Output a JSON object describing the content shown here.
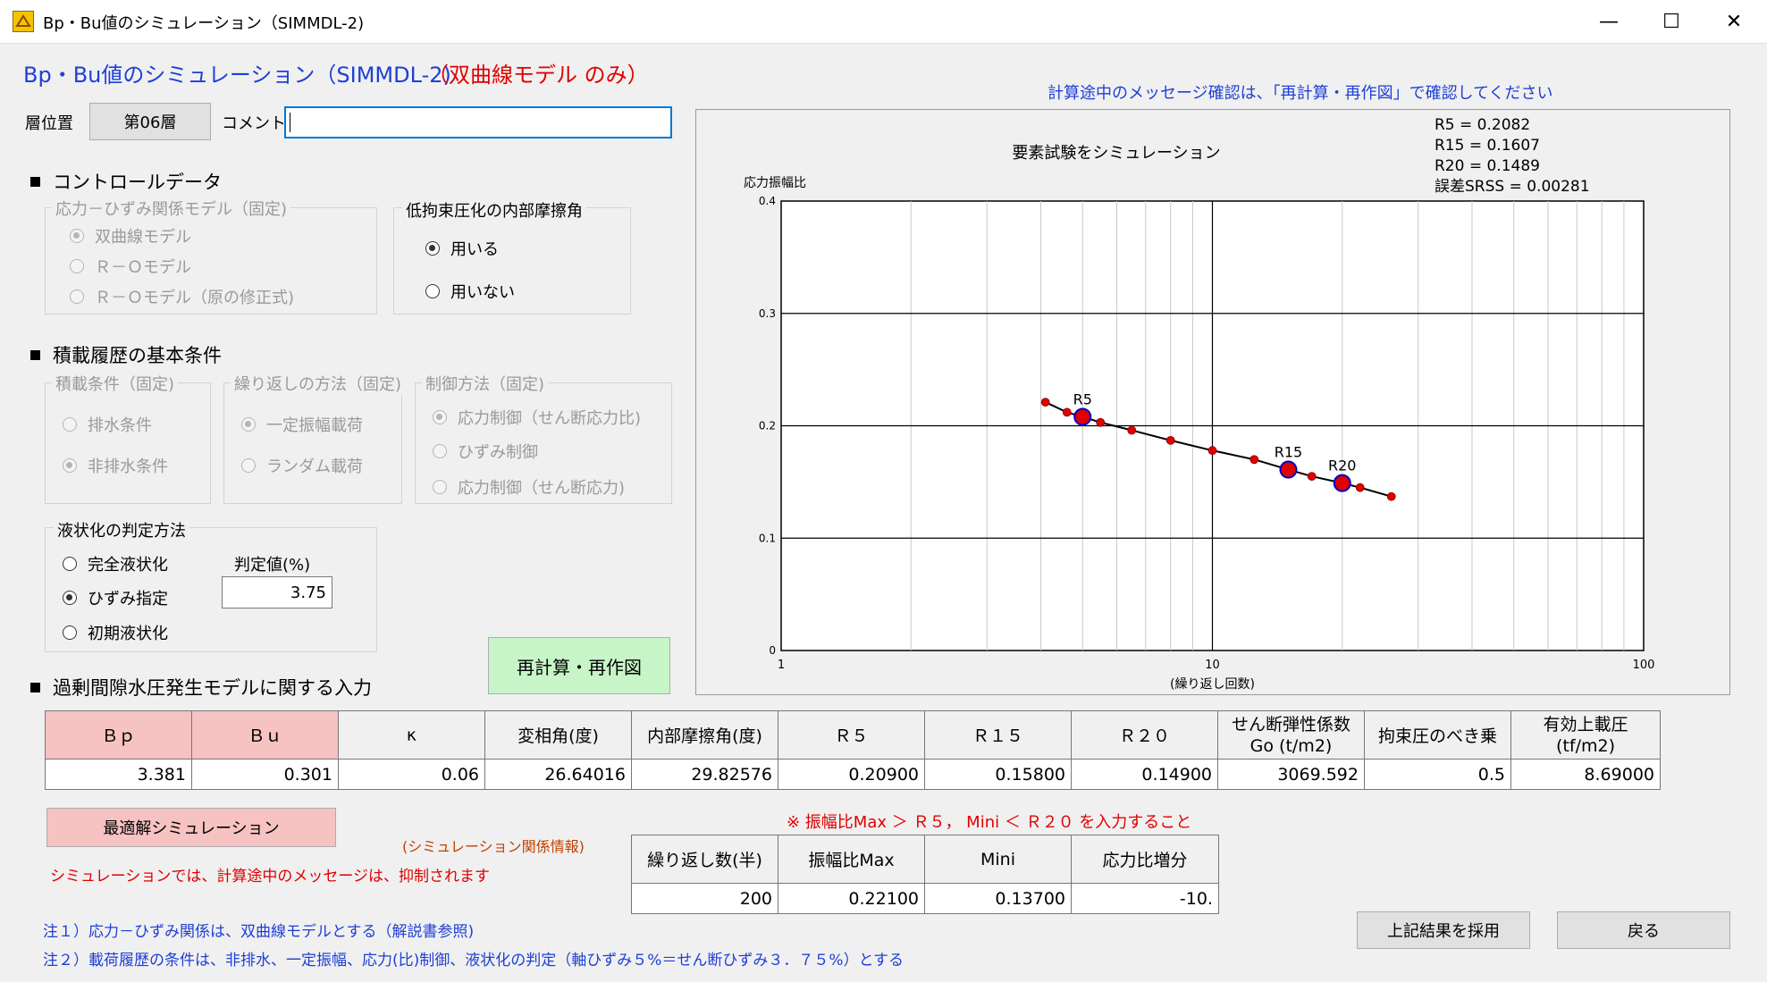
{
  "window": {
    "title": "Bp・Bu値のシミュレーション（SIMMDL-2)",
    "minimize": "—",
    "maximize": "☐",
    "close": "✕"
  },
  "header": {
    "title": "Bp・Bu値のシミュレーション（SIMMDL-2)",
    "subtitle": "（双曲線モデル のみ）",
    "notice": "計算途中のメッセージ確認は、「再計算・再作図」で確認してください"
  },
  "layer": {
    "label": "層位置",
    "value": "第06層",
    "comment_label": "コメント",
    "comment_value": ""
  },
  "control": {
    "title": "コントロールデータ",
    "model_group": "応力－ひずみ関係モデル（固定)",
    "model_options": [
      "双曲線モデル",
      "Ｒ－Ｏモデル",
      "Ｒ－Ｏモデル（原の修正式)"
    ],
    "model_selected": 0,
    "friction_group": "低拘束圧化の内部摩擦角",
    "friction_options": [
      "用いる",
      "用いない"
    ],
    "friction_selected": 0
  },
  "loading": {
    "title": "積載履歴の基本条件",
    "cond_group": "積載条件（固定)",
    "cond_options": [
      "排水条件",
      "非排水条件"
    ],
    "cond_selected": 1,
    "repeat_group": "繰り返しの方法（固定)",
    "repeat_options": [
      "一定振幅載荷",
      "ランダム載荷"
    ],
    "repeat_selected": 0,
    "ctrl_group": "制御方法（固定)",
    "ctrl_options": [
      "応力制御（せん断応力比)",
      "ひずみ制御",
      "応力制御（せん断応力)"
    ],
    "ctrl_selected": 0,
    "liq_group": "液状化の判定方法",
    "liq_options": [
      "完全液状化",
      "ひずみ指定",
      "初期液状化"
    ],
    "liq_selected": 1,
    "judge_label": "判定値(%)",
    "judge_value": "3.75"
  },
  "recalc_button": "再計算・再作図",
  "pore": {
    "title": "過剰間隙水圧発生モデルに関する入力",
    "headers": [
      "Ｂｐ",
      "Ｂｕ",
      "κ",
      "変相角(度)",
      "内部摩擦角(度)",
      "Ｒ５",
      "Ｒ１５",
      "Ｒ２０",
      "せん断弾性係数\nGo (t/m2)",
      "拘束圧のべき乗",
      "有効上載圧\n(tf/m2)"
    ],
    "values": [
      "3.381",
      "0.301",
      "0.06",
      "26.64016",
      "29.82576",
      "0.20900",
      "0.15800",
      "0.14900",
      "3069.592",
      "0.5",
      "8.69000"
    ]
  },
  "sim": {
    "button": "最適解シミュレーション",
    "info_label": "(シミュレーション関係情報)",
    "suppress_note": "シミュレーションでは、計算途中のメッセージは、抑制されます",
    "warning": "※ 振幅比Max ＞ Ｒ５， Mini ＜ Ｒ２０ を入力すること",
    "headers": [
      "繰り返し数(半)",
      "振幅比Max",
      "Mini",
      "応力比増分"
    ],
    "values": [
      "200",
      "0.22100",
      "0.13700",
      "-10."
    ]
  },
  "notes": [
    "注１）応力－ひずみ関係は、双曲線モデルとする（解説書参照)",
    "注２）載荷履歴の条件は、非排水、一定振幅、応力(比)制御、液状化の判定（軸ひずみ５%＝せん断ひずみ３．７５%）とする"
  ],
  "buttons": {
    "adopt": "上記結果を採用",
    "back": "戻る"
  },
  "chart_data": {
    "type": "scatter",
    "title": "要素試験をシミュレーション",
    "xlabel": "(繰り返し回数)",
    "ylabel": "応力振幅比",
    "x_scale": "log",
    "xlim": [
      1,
      100
    ],
    "ylim": [
      0,
      0.4
    ],
    "x_ticks": [
      "1",
      "10",
      "100"
    ],
    "y_ticks": [
      "0",
      "0.1",
      "0.2",
      "0.3",
      "0.4"
    ],
    "grid": true,
    "stats": [
      "R5  = 0.2082",
      "R15 = 0.1607",
      "R20 = 0.1489",
      "誤差SRSS = 0.00281"
    ],
    "series": [
      {
        "name": "",
        "x": [
          4.1,
          4.6,
          5.0,
          5.5,
          6.5,
          8.0,
          10.0,
          12.5,
          15.0,
          17.0,
          20.0,
          22.0,
          26.0
        ],
        "y": [
          0.221,
          0.212,
          0.208,
          0.203,
          0.196,
          0.187,
          0.178,
          0.17,
          0.161,
          0.155,
          0.149,
          0.145,
          0.137
        ]
      }
    ],
    "markers": [
      {
        "label": "R5",
        "x": 5.0,
        "y": 0.208
      },
      {
        "label": "R15",
        "x": 15.0,
        "y": 0.161
      },
      {
        "label": "R20",
        "x": 20.0,
        "y": 0.149
      }
    ],
    "colors": {
      "point": "#e00000",
      "marker": "#e00000",
      "marker_edge": "#0000c8",
      "line": "#000000"
    }
  }
}
